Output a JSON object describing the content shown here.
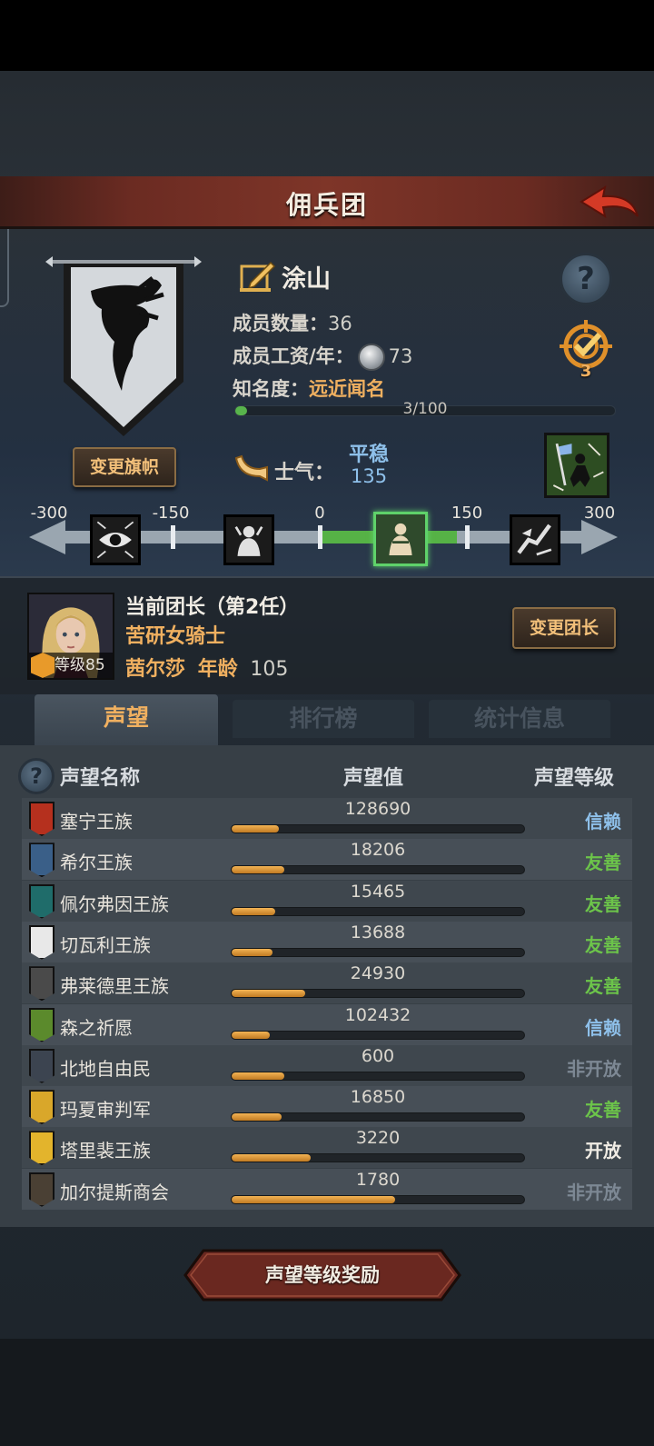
{
  "header": {
    "title": "佣兵团"
  },
  "company": {
    "name": "涂山",
    "members_label": "成员数量：",
    "members_value": "36",
    "wage_label": "成员工资/年：",
    "wage_value": "73",
    "fame_label": "知名度：",
    "fame_value": "远近闻名",
    "fame_progress_text": "3/100",
    "fame_progress": 0.03,
    "change_flag_label": "变更旗帜",
    "quest_count": "3"
  },
  "morale": {
    "label": "士气：",
    "state": "平稳",
    "value": "135",
    "scale_labels": [
      "-300",
      "-150",
      "0",
      "150",
      "300"
    ]
  },
  "leader": {
    "title": "当前团长（第2任）",
    "class": "苦研女骑士",
    "name": "茜尔莎",
    "age_label": "年龄",
    "age": "105",
    "level_label": "等级85",
    "change_leader_label": "变更团长"
  },
  "tabs": [
    {
      "label": "声望",
      "active": true
    },
    {
      "label": "排行榜",
      "active": false
    },
    {
      "label": "统计信息",
      "active": false
    }
  ],
  "table": {
    "headers": [
      "声望名称",
      "声望值",
      "声望等级"
    ],
    "rows": [
      {
        "name": "塞宁王族",
        "value": "128690",
        "progress": 0.16,
        "level": "信赖",
        "level_color": "#8ec0ea",
        "icon_color": "#b5301e"
      },
      {
        "name": "希尔王族",
        "value": "18206",
        "progress": 0.18,
        "level": "友善",
        "level_color": "#6cc44a",
        "icon_color": "#3a5f88"
      },
      {
        "name": "佩尔弗因王族",
        "value": "15465",
        "progress": 0.15,
        "level": "友善",
        "level_color": "#6cc44a",
        "icon_color": "#1f6c6a"
      },
      {
        "name": "切瓦利王族",
        "value": "13688",
        "progress": 0.14,
        "level": "友善",
        "level_color": "#6cc44a",
        "icon_color": "#e8e8e8"
      },
      {
        "name": "弗莱德里王族",
        "value": "24930",
        "progress": 0.25,
        "level": "友善",
        "level_color": "#6cc44a",
        "icon_color": "#4a4a4a"
      },
      {
        "name": "森之祈愿",
        "value": "102432",
        "progress": 0.13,
        "level": "信赖",
        "level_color": "#8ec0ea",
        "icon_color": "#5b8a2c"
      },
      {
        "name": "北地自由民",
        "value": "600",
        "progress": 0.18,
        "level": "非开放",
        "level_color": "#7d8894",
        "icon_color": "#3c4450"
      },
      {
        "name": "玛夏审判军",
        "value": "16850",
        "progress": 0.17,
        "level": "友善",
        "level_color": "#6cc44a",
        "icon_color": "#d9a72a"
      },
      {
        "name": "塔里裴王族",
        "value": "3220",
        "progress": 0.27,
        "level": "开放",
        "level_color": "#f0ece4",
        "icon_color": "#e3b42c"
      },
      {
        "name": "加尔提斯商会",
        "value": "1780",
        "progress": 0.56,
        "level": "非开放",
        "level_color": "#7d8894",
        "icon_color": "#4a4034"
      }
    ]
  },
  "reward_button": {
    "label": "声望等级奖励"
  }
}
